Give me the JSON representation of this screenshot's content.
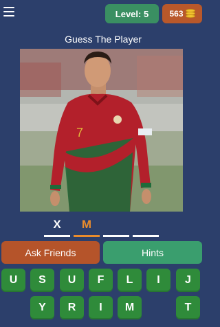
{
  "header": {
    "level_text": "Level: 5",
    "coins": "563"
  },
  "title": "Guess The Player",
  "answer_slots": [
    {
      "letter": "X",
      "color": "#ffffff",
      "active": false
    },
    {
      "letter": "M",
      "color": "#e98c2d",
      "active": true
    },
    {
      "letter": "",
      "color": "#ffffff",
      "active": false
    },
    {
      "letter": "",
      "color": "#ffffff",
      "active": false
    }
  ],
  "buttons": {
    "ask_friends": "Ask Friends",
    "hints": "Hints"
  },
  "keyboard": {
    "row1": [
      "U",
      "S",
      "U",
      "F",
      "L",
      "I",
      "J"
    ],
    "row2": [
      "Y",
      "R",
      "I",
      "M",
      "T"
    ]
  },
  "colors": {
    "background": "#2c3f6b",
    "level_badge": "#3a8f62",
    "coin_badge": "#b9582a",
    "ask_button": "#b5542a",
    "hints_button": "#3a9e6e",
    "key": "#2f8b3a",
    "active_slot": "#e98c2d"
  },
  "icons": {
    "menu": "hamburger-menu-icon",
    "coins": "coin-stack-icon"
  }
}
